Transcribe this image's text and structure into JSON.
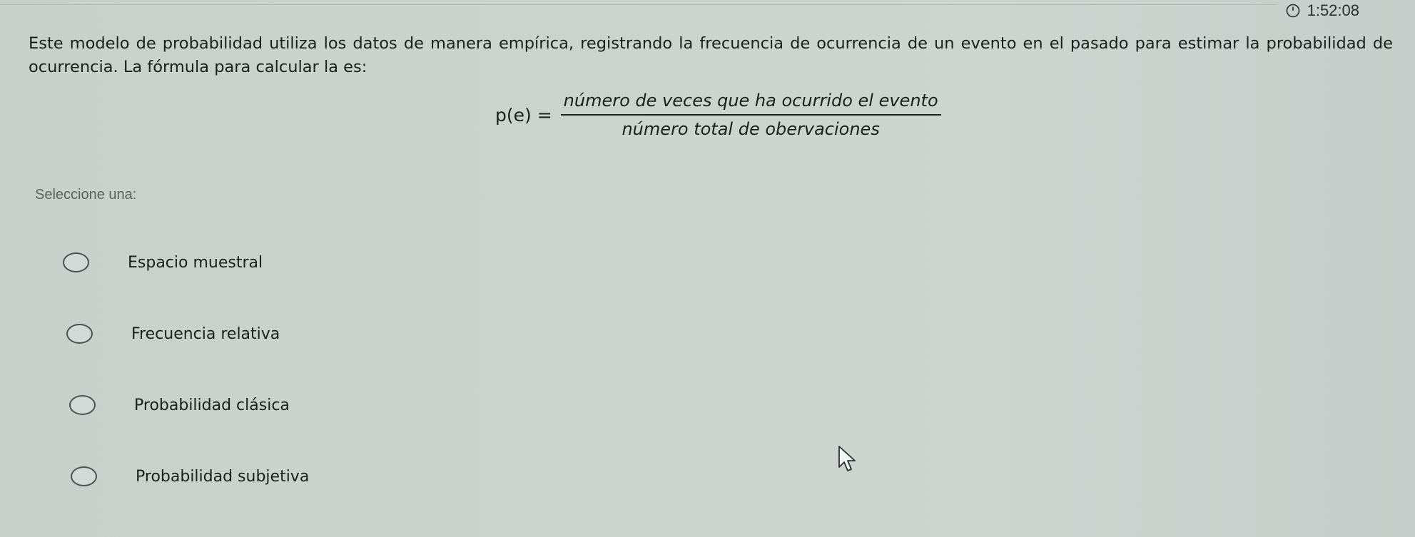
{
  "timer": {
    "icon": "clock-icon",
    "value": "1:52:08"
  },
  "question": {
    "text": "Este modelo de probabilidad utiliza los datos de manera empírica, registrando la frecuencia de ocurrencia de un evento en el pasado para estimar la probabilidad de ocurrencia. La fórmula para calcular la es:"
  },
  "formula": {
    "lhs": "p(e) =",
    "numerator": "número de veces que ha ocurrido el evento",
    "denominator": "número total de obervaciones"
  },
  "prompt": "Seleccione una:",
  "options": [
    {
      "label": "Espacio muestral"
    },
    {
      "label": "Frecuencia relativa"
    },
    {
      "label": "Probabilidad clásica"
    },
    {
      "label": "Probabilidad subjetiva"
    }
  ],
  "cursor": {
    "icon": "arrow-cursor-icon"
  }
}
